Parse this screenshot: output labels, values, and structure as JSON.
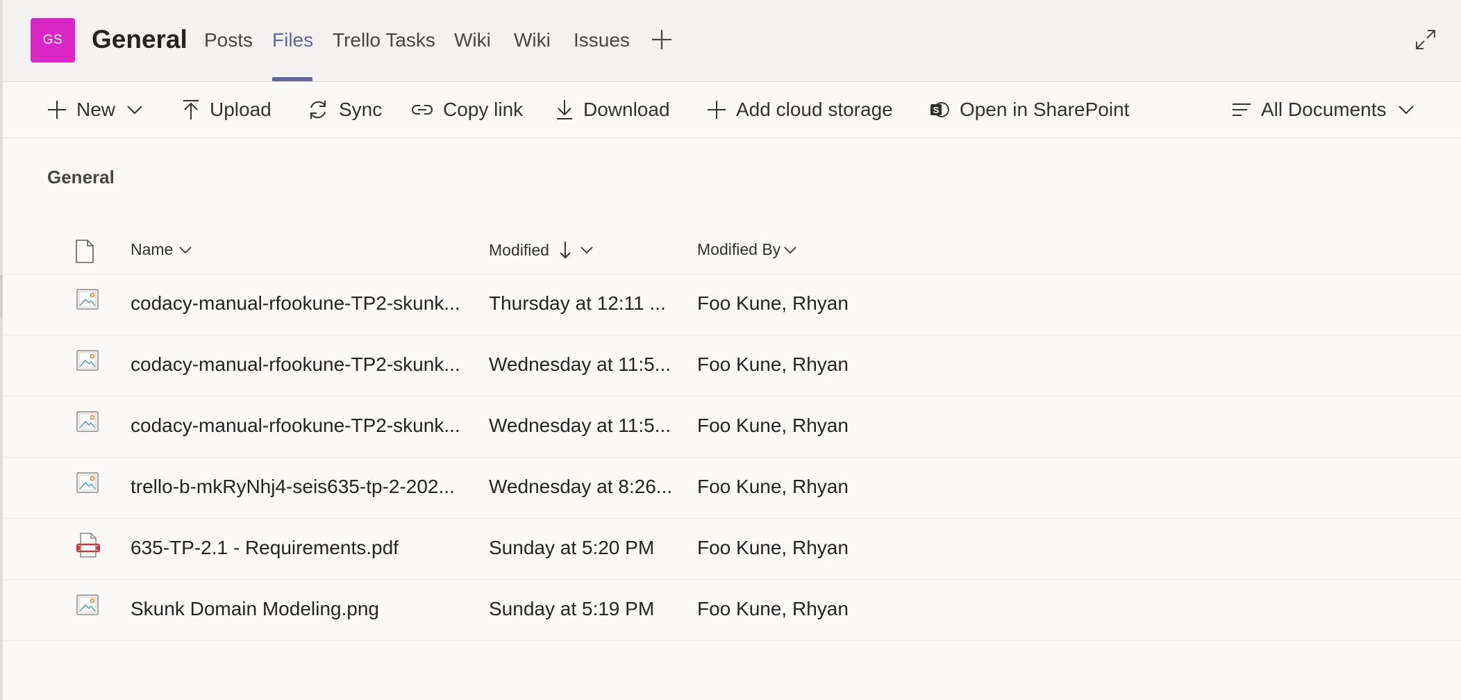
{
  "header": {
    "avatar_initials": "GS",
    "channel_title": "General",
    "tabs": [
      {
        "label": "Posts",
        "active": false
      },
      {
        "label": "Files",
        "active": true
      },
      {
        "label": "Trello Tasks",
        "active": false
      },
      {
        "label": "Wiki",
        "active": false
      },
      {
        "label": "Wiki",
        "active": false
      },
      {
        "label": "Issues",
        "active": false
      }
    ]
  },
  "toolbar": {
    "new_label": "New",
    "upload_label": "Upload",
    "sync_label": "Sync",
    "copy_link_label": "Copy link",
    "download_label": "Download",
    "add_cloud_storage_label": "Add cloud storage",
    "open_in_sharepoint_label": "Open in SharePoint",
    "view_label": "All Documents"
  },
  "folder": {
    "title": "General"
  },
  "columns": {
    "name": "Name",
    "modified": "Modified",
    "modified_by": "Modified By"
  },
  "files": [
    {
      "type": "image",
      "name": "codacy-manual-rfookune-TP2-skunk...",
      "modified": "Thursday at 12:11 ...",
      "modified_by": "Foo Kune, Rhyan"
    },
    {
      "type": "image",
      "name": "codacy-manual-rfookune-TP2-skunk...",
      "modified": "Wednesday at 11:5...",
      "modified_by": "Foo Kune, Rhyan"
    },
    {
      "type": "image",
      "name": "codacy-manual-rfookune-TP2-skunk...",
      "modified": "Wednesday at 11:5...",
      "modified_by": "Foo Kune, Rhyan"
    },
    {
      "type": "image",
      "name": "trello-b-mkRyNhj4-seis635-tp-2-202...",
      "modified": "Wednesday at 8:26...",
      "modified_by": "Foo Kune, Rhyan"
    },
    {
      "type": "pdf",
      "name": "635-TP-2.1 - Requirements.pdf",
      "modified": "Sunday at 5:20 PM",
      "modified_by": "Foo Kune, Rhyan"
    },
    {
      "type": "image",
      "name": "Skunk Domain Modeling.png",
      "modified": "Sunday at 5:19 PM",
      "modified_by": "Foo Kune, Rhyan"
    }
  ],
  "colors": {
    "accent": "#6264a7",
    "avatar": "#d926c4"
  }
}
